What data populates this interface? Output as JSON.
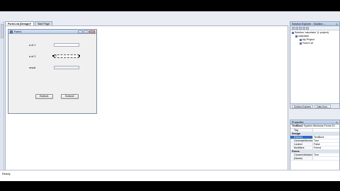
{
  "designer": {
    "tabs": [
      {
        "label": "Form1.vb [Design]*",
        "active": true
      },
      {
        "label": "Start Page",
        "active": false
      }
    ]
  },
  "form": {
    "title": "Form1",
    "labels": {
      "a": "a of 1",
      "b": "a of 2",
      "result": "result"
    },
    "textbox2_value": "0",
    "button1": "Button1",
    "button2": "Button2"
  },
  "solution_explorer": {
    "title": "Solution Explorer - Solution ...",
    "nodes": [
      {
        "label": "Solution 'calculator' (1 project)",
        "level": 1
      },
      {
        "label": "calculator",
        "level": 2
      },
      {
        "label": "My Project",
        "level": 3
      },
      {
        "label": "Form1.vb",
        "level": 3
      }
    ],
    "footer_tabs": [
      "Solution Explorer",
      "Data Sour..."
    ]
  },
  "properties": {
    "title": "Properties",
    "object": "TextBox1",
    "object_type": "System.Windows.Forms.Te...",
    "rows": [
      {
        "name": "Tag",
        "value": "",
        "type": "prop"
      },
      {
        "name": "Design",
        "value": "",
        "type": "cat"
      },
      {
        "name": "(Name)",
        "value": "TextBox1",
        "type": "selected"
      },
      {
        "name": "GenerateMember",
        "value": "True",
        "type": "prop"
      },
      {
        "name": "Locked",
        "value": "False",
        "type": "prop"
      },
      {
        "name": "Modifiers",
        "value": "Friend",
        "type": "prop"
      },
      {
        "name": "Focus",
        "value": "",
        "type": "cat"
      },
      {
        "name": "CausesValidation",
        "value": "True",
        "type": "prop"
      },
      {
        "name": "(Name)",
        "value": "",
        "type": "prop"
      }
    ]
  },
  "bottom_tabs": [
    "Output",
    "Error List",
    "Task List"
  ],
  "status": {
    "text": "Ready"
  }
}
